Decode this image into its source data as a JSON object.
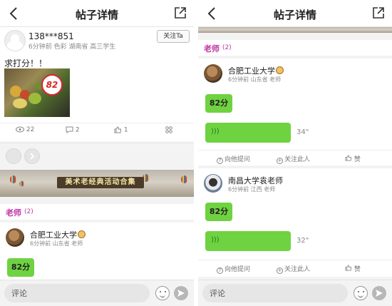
{
  "left": {
    "header": {
      "title": "帖子详情"
    },
    "post": {
      "username": "138***851",
      "meta": "6分钟前  色彩  湖南省    高三学生",
      "follow_label": "关注Ta",
      "text": "求打分！！",
      "score_badge": "82",
      "stats": {
        "views": "22",
        "comments": "2",
        "likes": "1"
      }
    },
    "banner_text": "美术老经典活动合集",
    "section": {
      "label": "老师",
      "count": "(2)"
    },
    "teacher1": {
      "name": "合肥工业大学",
      "meta": "6分钟前   山东省   老师",
      "score": "82分"
    },
    "bottom": {
      "comment_placeholder": "评论"
    }
  },
  "right": {
    "header": {
      "title": "帖子详情"
    },
    "section": {
      "label": "老师",
      "count": "(2)"
    },
    "teacher1": {
      "name": "合肥工业大学",
      "meta": "6分钟前   山东省   老师",
      "score": "82分",
      "voice_length": "34\"",
      "actions": {
        "ask": "向他提问",
        "follow": "关注此人",
        "like": "赞"
      }
    },
    "teacher2": {
      "name": "南昌大学袁老师",
      "meta": "6分钟前   江西   老师",
      "score": "82分",
      "voice_length": "32\"",
      "actions": {
        "ask": "向他提问",
        "follow": "关注此人",
        "like": "赞"
      }
    },
    "bottom": {
      "comment_placeholder": "评论"
    }
  },
  "colors": {
    "accent": "#c033a6",
    "bubble": "#6fd241"
  }
}
